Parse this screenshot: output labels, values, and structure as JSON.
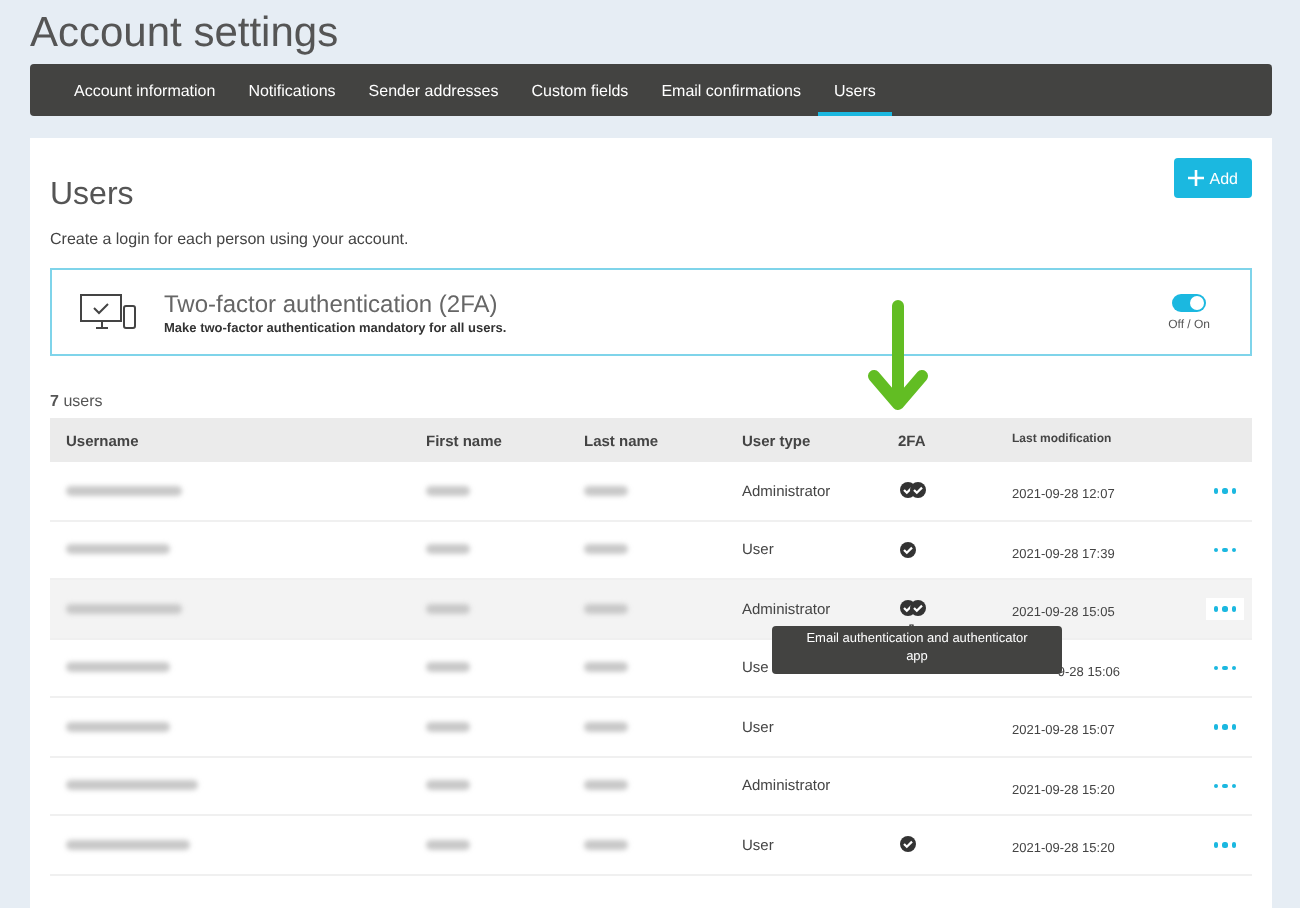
{
  "page_title": "Account settings",
  "tabs": [
    {
      "label": "Account information",
      "selected": false
    },
    {
      "label": "Notifications",
      "selected": false
    },
    {
      "label": "Sender addresses",
      "selected": false
    },
    {
      "label": "Custom fields",
      "selected": false
    },
    {
      "label": "Email confirmations",
      "selected": false
    },
    {
      "label": "Users",
      "selected": true
    }
  ],
  "section": {
    "title": "Users",
    "description": "Create a login for each person using your account.",
    "add_button": "Add"
  },
  "two_factor": {
    "title": "Two-factor authentication (2FA)",
    "description": "Make two-factor authentication mandatory for all users.",
    "on": true,
    "toggle_label": "Off / On"
  },
  "user_count": {
    "number": "7",
    "label": "users"
  },
  "table": {
    "columns": [
      "Username",
      "First name",
      "Last name",
      "User type",
      "2FA",
      "Last modification"
    ],
    "rows": [
      {
        "user_type": "Administrator",
        "kind": "double",
        "modified": "2021-09-28 12:07",
        "hovered": false,
        "partial": false
      },
      {
        "user_type": "User",
        "kind": "single",
        "modified": "2021-09-28 17:39",
        "hovered": false,
        "partial": false
      },
      {
        "user_type": "Administrator",
        "kind": "double",
        "modified": "2021-09-28 15:05",
        "hovered": true,
        "partial": false
      },
      {
        "user_type": "Use",
        "kind": "none",
        "modified": "9-28 15:06",
        "hovered": false,
        "partial": true
      },
      {
        "user_type": "User",
        "kind": "none",
        "modified": "2021-09-28 15:07",
        "hovered": false,
        "partial": false
      },
      {
        "user_type": "Administrator",
        "kind": "none",
        "modified": "2021-09-28 15:20",
        "hovered": false,
        "partial": false
      },
      {
        "user_type": "User",
        "kind": "single",
        "modified": "2021-09-28 15:20",
        "hovered": false,
        "partial": false
      }
    ]
  },
  "tooltip": "Email authentication and authenticator app"
}
